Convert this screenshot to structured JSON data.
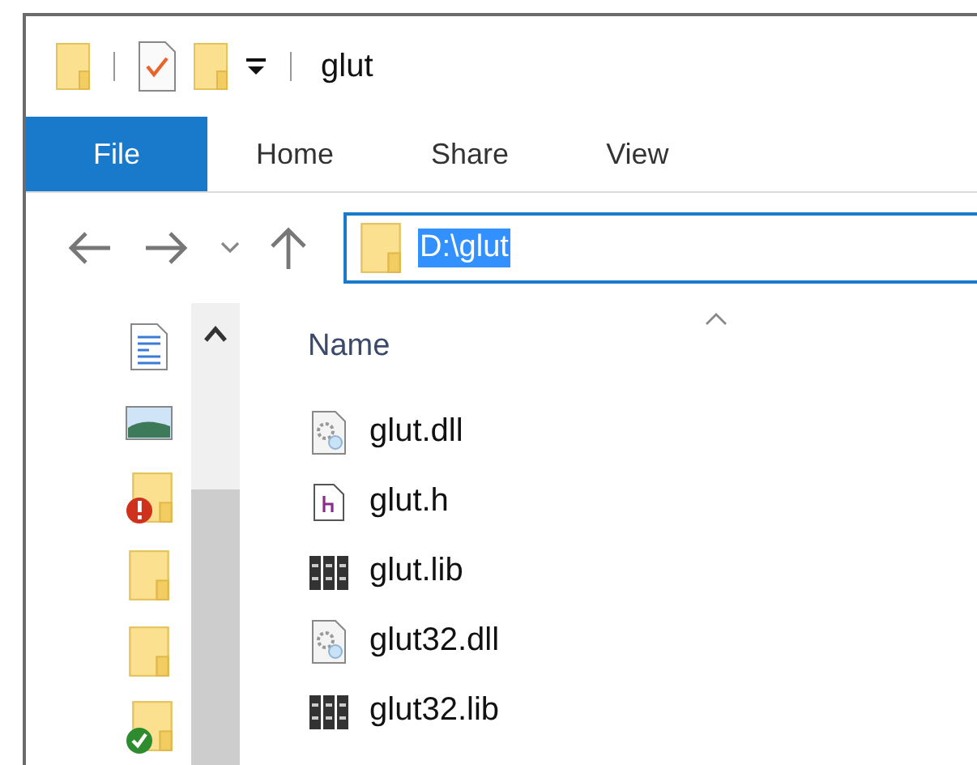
{
  "window": {
    "title": "glut"
  },
  "quick_access": [
    {
      "kind": "folder"
    },
    {
      "kind": "separator"
    },
    {
      "kind": "properties"
    },
    {
      "kind": "new-folder"
    },
    {
      "kind": "dropdown"
    },
    {
      "kind": "separator"
    }
  ],
  "ribbon_tabs": [
    {
      "label": "File",
      "kind": "file"
    },
    {
      "label": "Home",
      "kind": "tab"
    },
    {
      "label": "Share",
      "kind": "tab"
    },
    {
      "label": "View",
      "kind": "tab"
    }
  ],
  "address_bar": {
    "path": "D:\\glut",
    "text_selected": true
  },
  "nav_pane": {
    "items": [
      {
        "kind": "document"
      },
      {
        "kind": "image"
      },
      {
        "kind": "folder-error"
      },
      {
        "kind": "folder"
      },
      {
        "kind": "folder"
      },
      {
        "kind": "folder-ok"
      }
    ]
  },
  "file_list": {
    "column": "Name",
    "rows": [
      {
        "name": "glut.dll",
        "kind": "dll"
      },
      {
        "name": "glut.h",
        "kind": "header"
      },
      {
        "name": "glut.lib",
        "kind": "lib"
      },
      {
        "name": "glut32.dll",
        "kind": "dll"
      },
      {
        "name": "glut32.lib",
        "kind": "lib"
      }
    ]
  }
}
